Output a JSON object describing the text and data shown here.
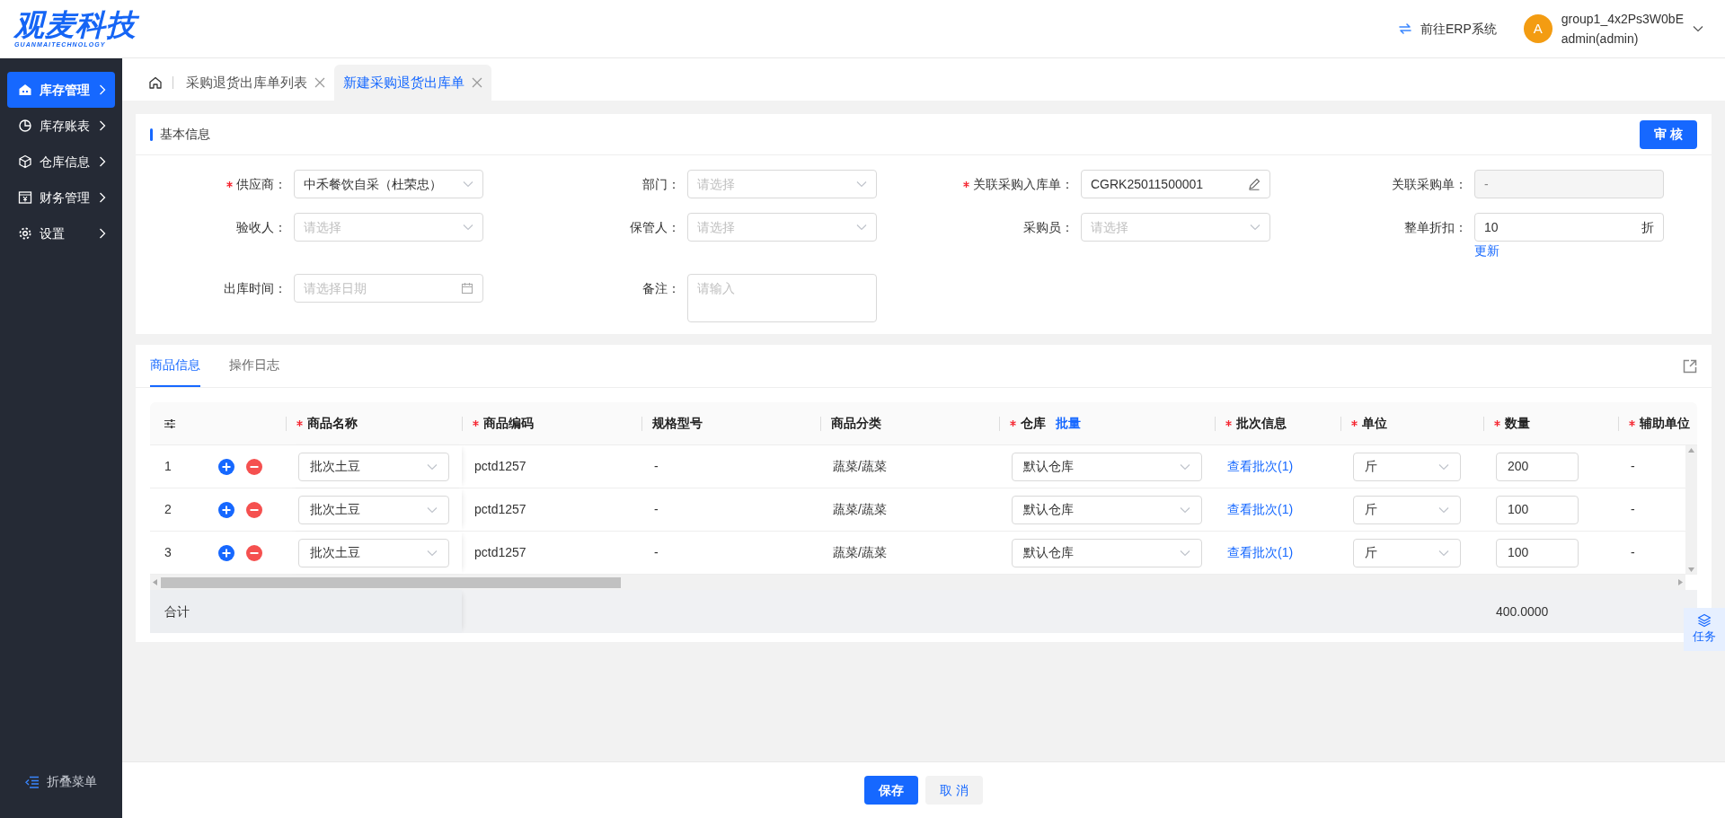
{
  "header": {
    "logo": "观麦科技",
    "logo_sub": "GUANMAITECHNOLOGY",
    "erp_link": "前往ERP系统",
    "avatar": "A",
    "user_name": "group1_4x2Ps3W0bE",
    "user_role": "admin(admin)"
  },
  "sidebar": {
    "items": [
      {
        "label": "库存管理",
        "selected": true
      },
      {
        "label": "库存账表",
        "selected": false
      },
      {
        "label": "仓库信息",
        "selected": false
      },
      {
        "label": "财务管理",
        "selected": false
      },
      {
        "label": "设置",
        "selected": false
      }
    ],
    "collapse": "折叠菜单"
  },
  "page_tabs": [
    {
      "label": "采购退货出库单列表",
      "selected": false
    },
    {
      "label": "新建采购退货出库单",
      "selected": true
    }
  ],
  "basic_info": {
    "title": "基本信息",
    "audit_button": "审 核",
    "fields": [
      {
        "label": "供应商：",
        "required": true,
        "kind": "select",
        "value": "中禾餐饮自采（杜荣忠）"
      },
      {
        "label": "部门：",
        "required": false,
        "kind": "select",
        "placeholder": "请选择"
      },
      {
        "label": "关联采购入库单：",
        "required": true,
        "kind": "edit",
        "value": "CGRK25011500001"
      },
      {
        "label": "关联采购单：",
        "required": false,
        "kind": "disabled",
        "value": "-"
      },
      {
        "label": "验收人：",
        "required": false,
        "kind": "select",
        "placeholder": "请选择"
      },
      {
        "label": "保管人：",
        "required": false,
        "kind": "select",
        "placeholder": "请选择"
      },
      {
        "label": "采购员：",
        "required": false,
        "kind": "select",
        "placeholder": "请选择"
      },
      {
        "label": "整单折扣：",
        "required": false,
        "kind": "suffix",
        "value": "10",
        "suffix": "折",
        "link": "更新"
      },
      {
        "label": "出库时间：",
        "required": false,
        "kind": "date",
        "placeholder": "请选择日期"
      },
      {
        "label": "备注：",
        "required": false,
        "kind": "textarea",
        "placeholder": "请输入"
      }
    ]
  },
  "detail_tabs": [
    {
      "label": "商品信息",
      "selected": true
    },
    {
      "label": "操作日志",
      "selected": false
    }
  ],
  "table": {
    "columns": [
      {
        "label": "商品名称",
        "required": true
      },
      {
        "label": "商品编码",
        "required": true
      },
      {
        "label": "规格型号",
        "required": false
      },
      {
        "label": "商品分类",
        "required": false
      },
      {
        "label": "仓库",
        "required": true,
        "link": "批量"
      },
      {
        "label": "批次信息",
        "required": true
      },
      {
        "label": "单位",
        "required": true
      },
      {
        "label": "数量",
        "required": true
      },
      {
        "label": "辅助单位",
        "required": true
      }
    ],
    "rows": [
      {
        "index": "1",
        "name": "批次土豆",
        "code": "pctd1257",
        "spec": "-",
        "category": "蔬菜/蔬菜",
        "warehouse": "默认仓库",
        "batch": "查看批次(1)",
        "unit": "斤",
        "quantity": "200",
        "aux_unit": "-"
      },
      {
        "index": "2",
        "name": "批次土豆",
        "code": "pctd1257",
        "spec": "-",
        "category": "蔬菜/蔬菜",
        "warehouse": "默认仓库",
        "batch": "查看批次(1)",
        "unit": "斤",
        "quantity": "100",
        "aux_unit": "-"
      },
      {
        "index": "3",
        "name": "批次土豆",
        "code": "pctd1257",
        "spec": "-",
        "category": "蔬菜/蔬菜",
        "warehouse": "默认仓库",
        "batch": "查看批次(1)",
        "unit": "斤",
        "quantity": "100",
        "aux_unit": "-"
      }
    ],
    "summary": {
      "label": "合计",
      "quantity_total": "400.0000"
    }
  },
  "task_button": "任务",
  "footer": {
    "save": "保存",
    "cancel": "取 消"
  }
}
